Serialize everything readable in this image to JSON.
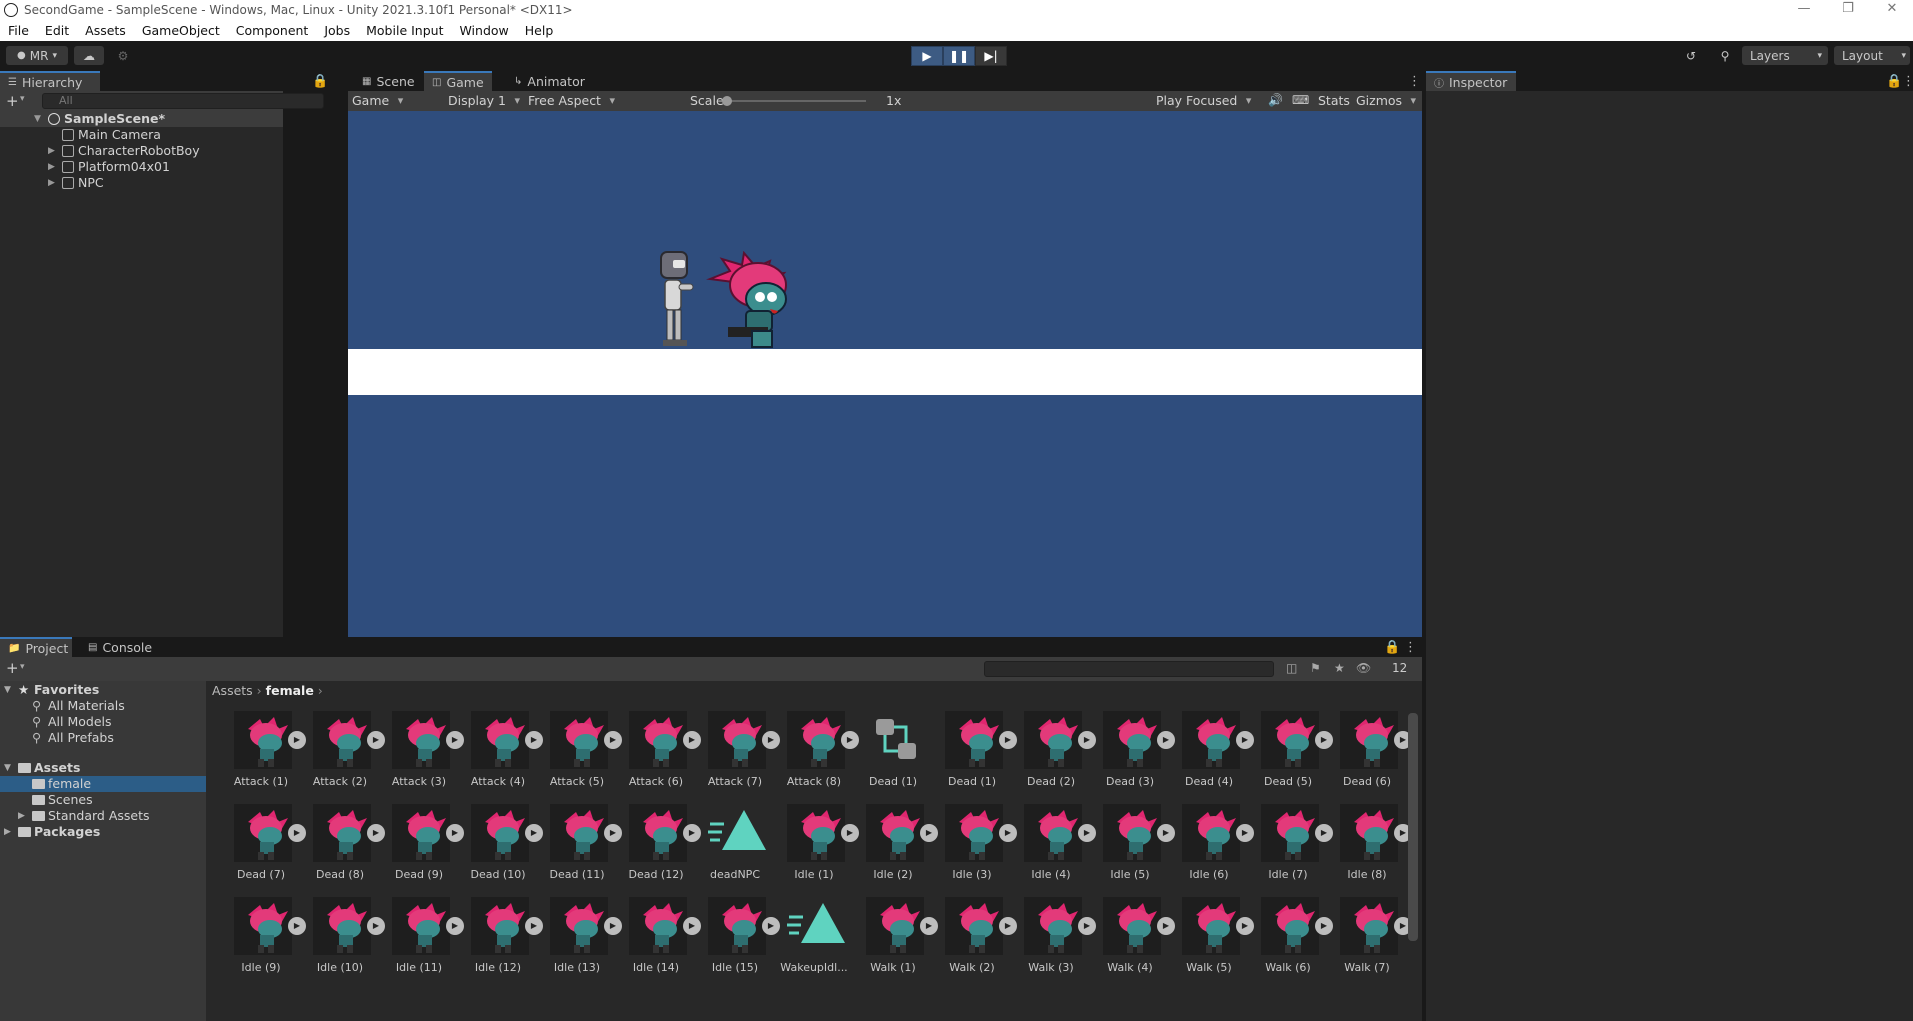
{
  "window": {
    "title": "SecondGame - SampleScene - Windows, Mac, Linux - Unity 2021.3.10f1 Personal* <DX11>",
    "controls": [
      "—",
      "❐",
      "✕"
    ]
  },
  "menu": [
    "File",
    "Edit",
    "Assets",
    "GameObject",
    "Component",
    "Jobs",
    "Mobile Input",
    "Window",
    "Help"
  ],
  "toolbar": {
    "account": "MR",
    "layers": "Layers",
    "layout": "Layout"
  },
  "hierarchy": {
    "tab": "Hierarchy",
    "search_placeholder": "All",
    "scene": "SampleScene*",
    "items": [
      "Main Camera",
      "CharacterRobotBoy",
      "Platform04x01",
      "NPC"
    ]
  },
  "views": {
    "tabs": [
      "Scene",
      "Game",
      "Animator"
    ],
    "game_mode": "Game",
    "display": "Display 1",
    "aspect": "Free Aspect",
    "scale_label": "Scale",
    "scale_value": "1x",
    "play_mode": "Play Focused",
    "stats": "Stats",
    "gizmos": "Gizmos"
  },
  "inspector": {
    "tab": "Inspector"
  },
  "project": {
    "tabs": [
      "Project",
      "Console"
    ],
    "hidden_count": "12",
    "favorites": {
      "label": "Favorites",
      "items": [
        "All Materials",
        "All Models",
        "All Prefabs"
      ]
    },
    "assets": {
      "label": "Assets",
      "folders": [
        "female",
        "Scenes",
        "Standard Assets"
      ]
    },
    "packages": "Packages",
    "breadcrumb": [
      "Assets",
      "female"
    ],
    "grid_row1": [
      "Attack (1)",
      "Attack (2)",
      "Attack (3)",
      "Attack (4)",
      "Attack (5)",
      "Attack (6)",
      "Attack (7)",
      "Attack (8)",
      "Dead (1)",
      "Dead (1)",
      "Dead (2)",
      "Dead (3)",
      "Dead (4)",
      "Dead (5)",
      "Dead (6)"
    ],
    "grid_row2": [
      "Dead (7)",
      "Dead (8)",
      "Dead (9)",
      "Dead (10)",
      "Dead (11)",
      "Dead (12)",
      "deadNPC",
      "Idle (1)",
      "Idle (2)",
      "Idle (3)",
      "Idle (4)",
      "Idle (5)",
      "Idle (6)",
      "Idle (7)",
      "Idle (8)"
    ],
    "grid_row3": [
      "Idle (9)",
      "Idle (10)",
      "Idle (11)",
      "Idle (12)",
      "Idle (13)",
      "Idle (14)",
      "Idle (15)",
      "WakeupIdl...",
      "Walk (1)",
      "Walk (2)",
      "Walk (3)",
      "Walk (4)",
      "Walk (5)",
      "Walk (6)",
      "Walk (7)"
    ]
  }
}
